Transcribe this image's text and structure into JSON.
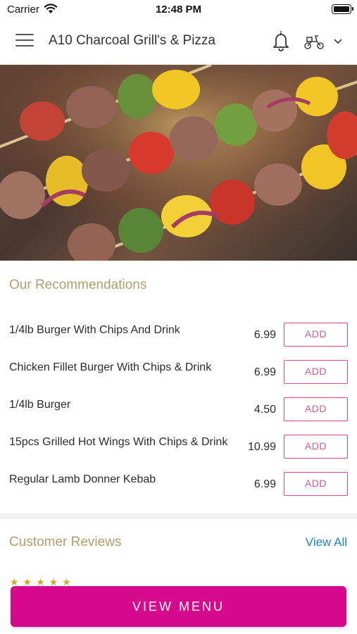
{
  "status_bar": {
    "carrier": "Carrier",
    "time": "12:48 PM"
  },
  "header": {
    "title": "A10 Charcoal Grill's & Pizza",
    "icons": [
      "hamburger-menu-icon",
      "bell-icon",
      "delivery-scooter-icon",
      "chevron-down-icon"
    ]
  },
  "recommendations": {
    "title": "Our Recommendations",
    "items": [
      {
        "name": "1/4lb Burger With Chips And Drink",
        "price": "6.99",
        "add_label": "ADD"
      },
      {
        "name": "Chicken Fillet Burger With Chips & Drink",
        "price": "6.99",
        "add_label": "ADD"
      },
      {
        "name": "1/4lb Burger",
        "price": "4.50",
        "add_label": "ADD"
      },
      {
        "name": "15pcs Grilled Hot Wings With Chips & Drink",
        "price": "10.99",
        "add_label": "ADD"
      },
      {
        "name": "Regular Lamb Donner Kebab",
        "price": "6.99",
        "add_label": "ADD"
      }
    ]
  },
  "reviews": {
    "title": "Customer Reviews",
    "view_all": "View All"
  },
  "footer": {
    "view_menu_label": "VIEW MENU"
  },
  "colors": {
    "accent": "#d6088c",
    "add_border": "#e1458f",
    "section_title": "#b49d6e",
    "link": "#1c88b8"
  }
}
